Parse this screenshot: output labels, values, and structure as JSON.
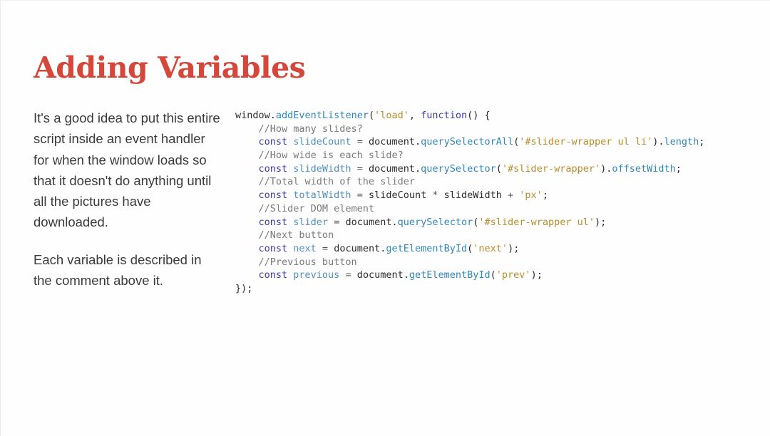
{
  "slide": {
    "title": "Adding Variables",
    "paragraphs": [
      "It's a good idea to put this entire script inside an event handler for when the window loads so that it doesn't do anything until all the pictures have downloaded.",
      "Each variable is described in the comment above it."
    ]
  },
  "code": {
    "lines": [
      [
        {
          "t": "plain",
          "v": "window."
        },
        {
          "t": "fn",
          "v": "addEventListener"
        },
        {
          "t": "plain",
          "v": "("
        },
        {
          "t": "str",
          "v": "'load'"
        },
        {
          "t": "plain",
          "v": ", "
        },
        {
          "t": "kw",
          "v": "function"
        },
        {
          "t": "plain",
          "v": "() {"
        }
      ],
      [
        {
          "t": "com",
          "v": "    //How many slides?"
        }
      ],
      [
        {
          "t": "kw",
          "v": "    const "
        },
        {
          "t": "var",
          "v": "slideCount"
        },
        {
          "t": "op",
          "v": " = "
        },
        {
          "t": "plain",
          "v": "document."
        },
        {
          "t": "fn",
          "v": "querySelectorAll"
        },
        {
          "t": "plain",
          "v": "("
        },
        {
          "t": "str",
          "v": "'#slider-wrapper ul li'"
        },
        {
          "t": "plain",
          "v": ")."
        },
        {
          "t": "fn",
          "v": "length"
        },
        {
          "t": "plain",
          "v": ";"
        }
      ],
      [
        {
          "t": "com",
          "v": "    //How wide is each slide?"
        }
      ],
      [
        {
          "t": "kw",
          "v": "    const "
        },
        {
          "t": "var",
          "v": "slideWidth"
        },
        {
          "t": "op",
          "v": " = "
        },
        {
          "t": "plain",
          "v": "document."
        },
        {
          "t": "fn",
          "v": "querySelector"
        },
        {
          "t": "plain",
          "v": "("
        },
        {
          "t": "str",
          "v": "'#slider-wrapper'"
        },
        {
          "t": "plain",
          "v": ")."
        },
        {
          "t": "fn",
          "v": "offsetWidth"
        },
        {
          "t": "plain",
          "v": ";"
        }
      ],
      [
        {
          "t": "com",
          "v": "    //Total width of the slider"
        }
      ],
      [
        {
          "t": "kw",
          "v": "    const "
        },
        {
          "t": "var",
          "v": "totalWidth"
        },
        {
          "t": "op",
          "v": " = "
        },
        {
          "t": "plain",
          "v": "slideCount "
        },
        {
          "t": "op",
          "v": "* "
        },
        {
          "t": "plain",
          "v": "slideWidth "
        },
        {
          "t": "op",
          "v": "+ "
        },
        {
          "t": "str",
          "v": "'px'"
        },
        {
          "t": "plain",
          "v": ";"
        }
      ],
      [
        {
          "t": "com",
          "v": "    //Slider DOM element"
        }
      ],
      [
        {
          "t": "kw",
          "v": "    const "
        },
        {
          "t": "var",
          "v": "slider"
        },
        {
          "t": "op",
          "v": " = "
        },
        {
          "t": "plain",
          "v": "document."
        },
        {
          "t": "fn",
          "v": "querySelector"
        },
        {
          "t": "plain",
          "v": "("
        },
        {
          "t": "str",
          "v": "'#slider-wrapper ul'"
        },
        {
          "t": "plain",
          "v": ");"
        }
      ],
      [
        {
          "t": "com",
          "v": "    //Next button"
        }
      ],
      [
        {
          "t": "kw",
          "v": "    const "
        },
        {
          "t": "var",
          "v": "next"
        },
        {
          "t": "op",
          "v": " = "
        },
        {
          "t": "plain",
          "v": "document."
        },
        {
          "t": "fn",
          "v": "getElementById"
        },
        {
          "t": "plain",
          "v": "("
        },
        {
          "t": "str",
          "v": "'next'"
        },
        {
          "t": "plain",
          "v": ");"
        }
      ],
      [
        {
          "t": "com",
          "v": "    //Previous button"
        }
      ],
      [
        {
          "t": "kw",
          "v": "    const "
        },
        {
          "t": "var",
          "v": "previous"
        },
        {
          "t": "op",
          "v": " = "
        },
        {
          "t": "plain",
          "v": "document."
        },
        {
          "t": "fn",
          "v": "getElementById"
        },
        {
          "t": "plain",
          "v": "("
        },
        {
          "t": "str",
          "v": "'prev'"
        },
        {
          "t": "plain",
          "v": ");"
        }
      ],
      [
        {
          "t": "plain",
          "v": "});"
        }
      ]
    ]
  },
  "colors": {
    "title": "#d6473b",
    "body_text": "#3a3a3a",
    "keyword": "#3a3aa8",
    "function": "#2f86b8",
    "variable": "#4f8fbf",
    "string": "#b88d2a",
    "comment": "#7a7a7a"
  }
}
